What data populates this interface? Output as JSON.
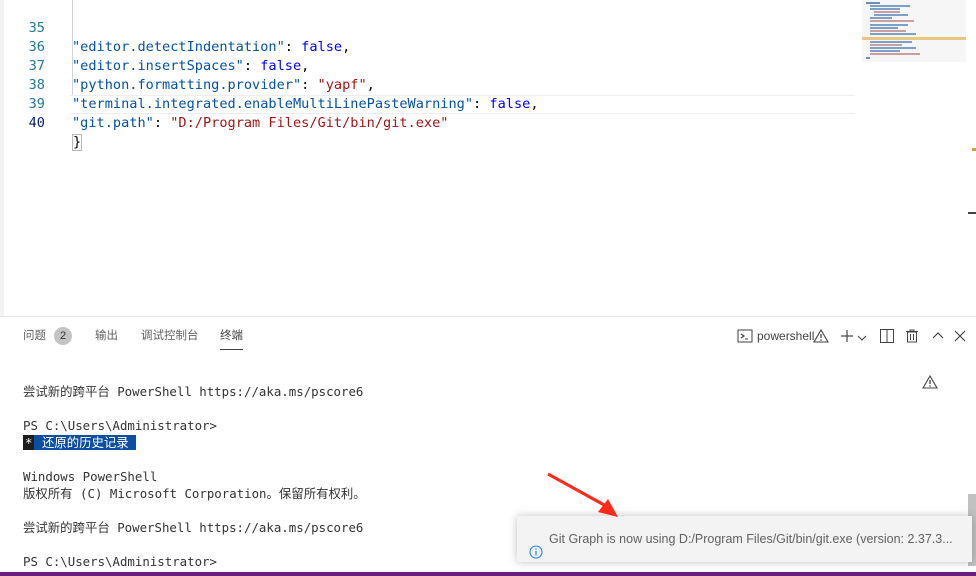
{
  "editor": {
    "lines": [
      {
        "num": "35",
        "key": "\"editor.detectIndentation\"",
        "sep": ": ",
        "value": "false",
        "value_type": "bool",
        "end": ","
      },
      {
        "num": "36",
        "key": "\"editor.insertSpaces\"",
        "sep": ": ",
        "value": "false",
        "value_type": "bool",
        "end": ","
      },
      {
        "num": "37",
        "key": "\"python.formatting.provider\"",
        "sep": ": ",
        "value": "\"yapf\"",
        "value_type": "string",
        "end": ","
      },
      {
        "num": "38",
        "key": "\"terminal.integrated.enableMultiLinePasteWarning\"",
        "sep": ": ",
        "value": "false",
        "value_type": "bool",
        "end": ","
      },
      {
        "num": "39",
        "key": "\"git.path\"",
        "sep": ": ",
        "value": "\"D:/Program Files/Git/bin/git.exe\"",
        "value_type": "string",
        "end": ""
      }
    ],
    "last_line": {
      "num": "40",
      "text": "}"
    }
  },
  "panel": {
    "tabs": [
      {
        "label": "问题"
      },
      {
        "label": "输出"
      },
      {
        "label": "调试控制台"
      },
      {
        "label": "终端"
      }
    ],
    "problems_count": "2",
    "terminal_name": "powershell"
  },
  "terminal": {
    "lines": [
      "尝试新的跨平台 PowerShell https://aka.ms/pscore6",
      "",
      "PS C:\\Users\\Administrator>",
      "",
      "",
      "Windows PowerShell",
      "版权所有 (C) Microsoft Corporation。保留所有权利。",
      "",
      "尝试新的跨平台 PowerShell https://aka.ms/pscore6",
      "",
      "PS C:\\Users\\Administrator>"
    ],
    "restore_star": "*",
    "restore_text": "还原的历史记录"
  },
  "notification": {
    "text": "Git Graph is now using D:/Program Files/Git/bin/git.exe (version: 2.37.3..."
  },
  "colors": {
    "key": "#0451a5",
    "string": "#a31515",
    "boolean": "#0000ff",
    "line_number": "#237893",
    "selection": "#0b4ea2",
    "status_bar": "#68217a",
    "annotation_arrow": "#ff2a1a"
  },
  "icons": [
    "terminal-icon",
    "warning-icon",
    "plus-icon",
    "chevron-down-icon",
    "split-icon",
    "trash-icon",
    "chevron-up-icon",
    "close-icon",
    "info-icon"
  ]
}
